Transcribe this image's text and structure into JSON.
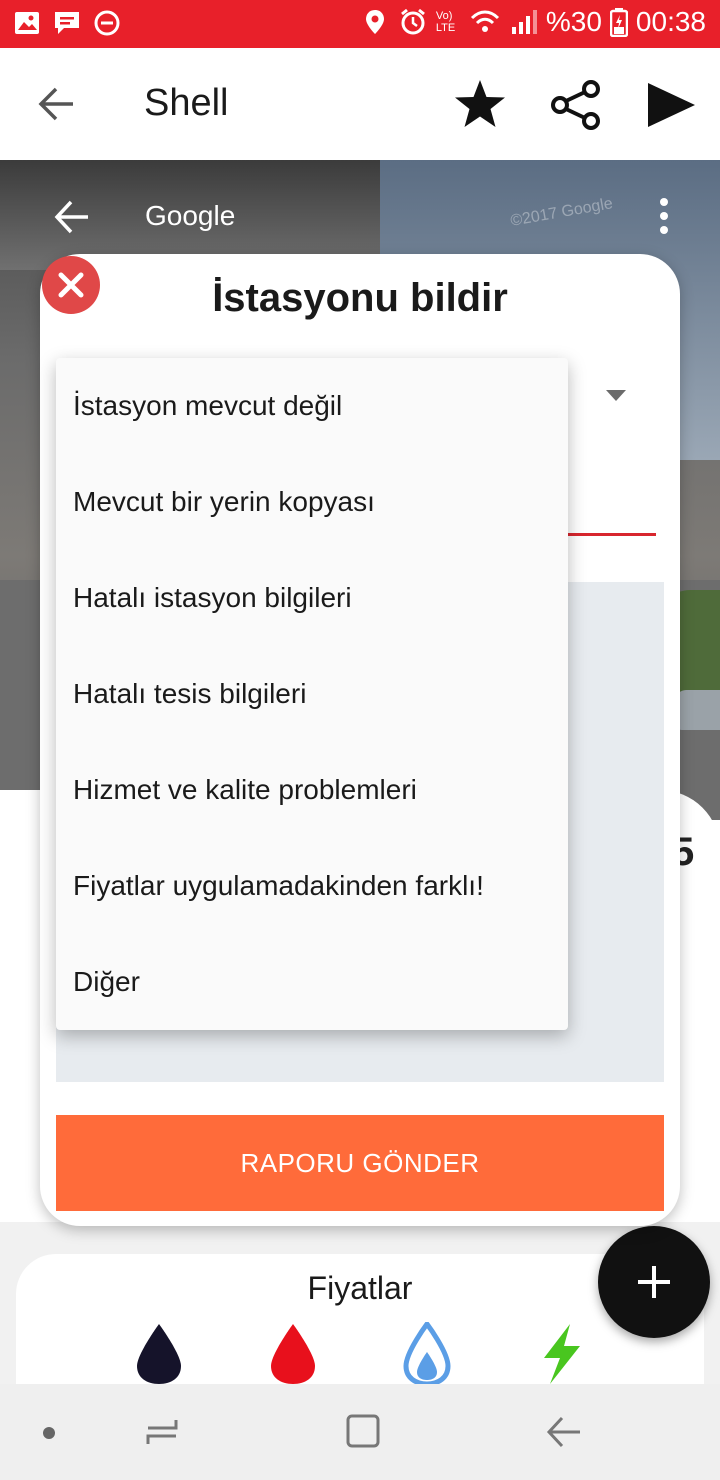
{
  "status_bar": {
    "battery_percent": "%30",
    "time": "00:38",
    "network": "Vo) LTE",
    "bg_color": "#e8202a"
  },
  "app_bar": {
    "title": "Shell",
    "icons": [
      "back-arrow-icon",
      "star-icon",
      "share-icon",
      "play-icon"
    ]
  },
  "street_view": {
    "title": "Google",
    "copyright": "©2017 Google"
  },
  "dialog": {
    "title": "İstasyonu bildir",
    "submit_label": "RAPORU GÖNDER",
    "submit_color": "#ff6b3a",
    "accent_color": "#d8262e"
  },
  "dropdown": {
    "options": [
      "İstasyon mevcut değil",
      "Mevcut bir yerin kopyası",
      "Hatalı istasyon bilgileri",
      "Hatalı tesis bilgileri",
      "Hizmet ve kalite problemleri",
      "Fiyatlar uygulamadakinden farklı!",
      "Diğer"
    ]
  },
  "background": {
    "peek_char": "5"
  },
  "prices": {
    "title": "Fiyatlar",
    "fuel_icons": [
      "dark-fuel-drop-icon",
      "red-fuel-drop-icon",
      "gas-flame-icon",
      "electric-bolt-icon"
    ]
  }
}
